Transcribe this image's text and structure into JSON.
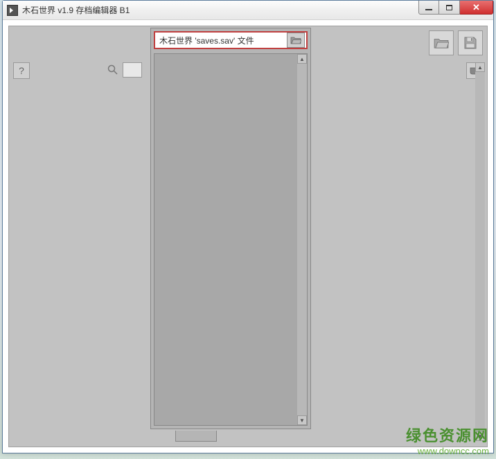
{
  "window": {
    "title": "木石世界 v1.9 存档编辑器 B1"
  },
  "toolbar": {
    "help_label": "?",
    "cup_label": "☕"
  },
  "file_input": {
    "text": "木石世界 'saves.sav' 文件"
  },
  "watermark": {
    "text_cn": "绿色资源网",
    "url": "www.downcc.com"
  }
}
